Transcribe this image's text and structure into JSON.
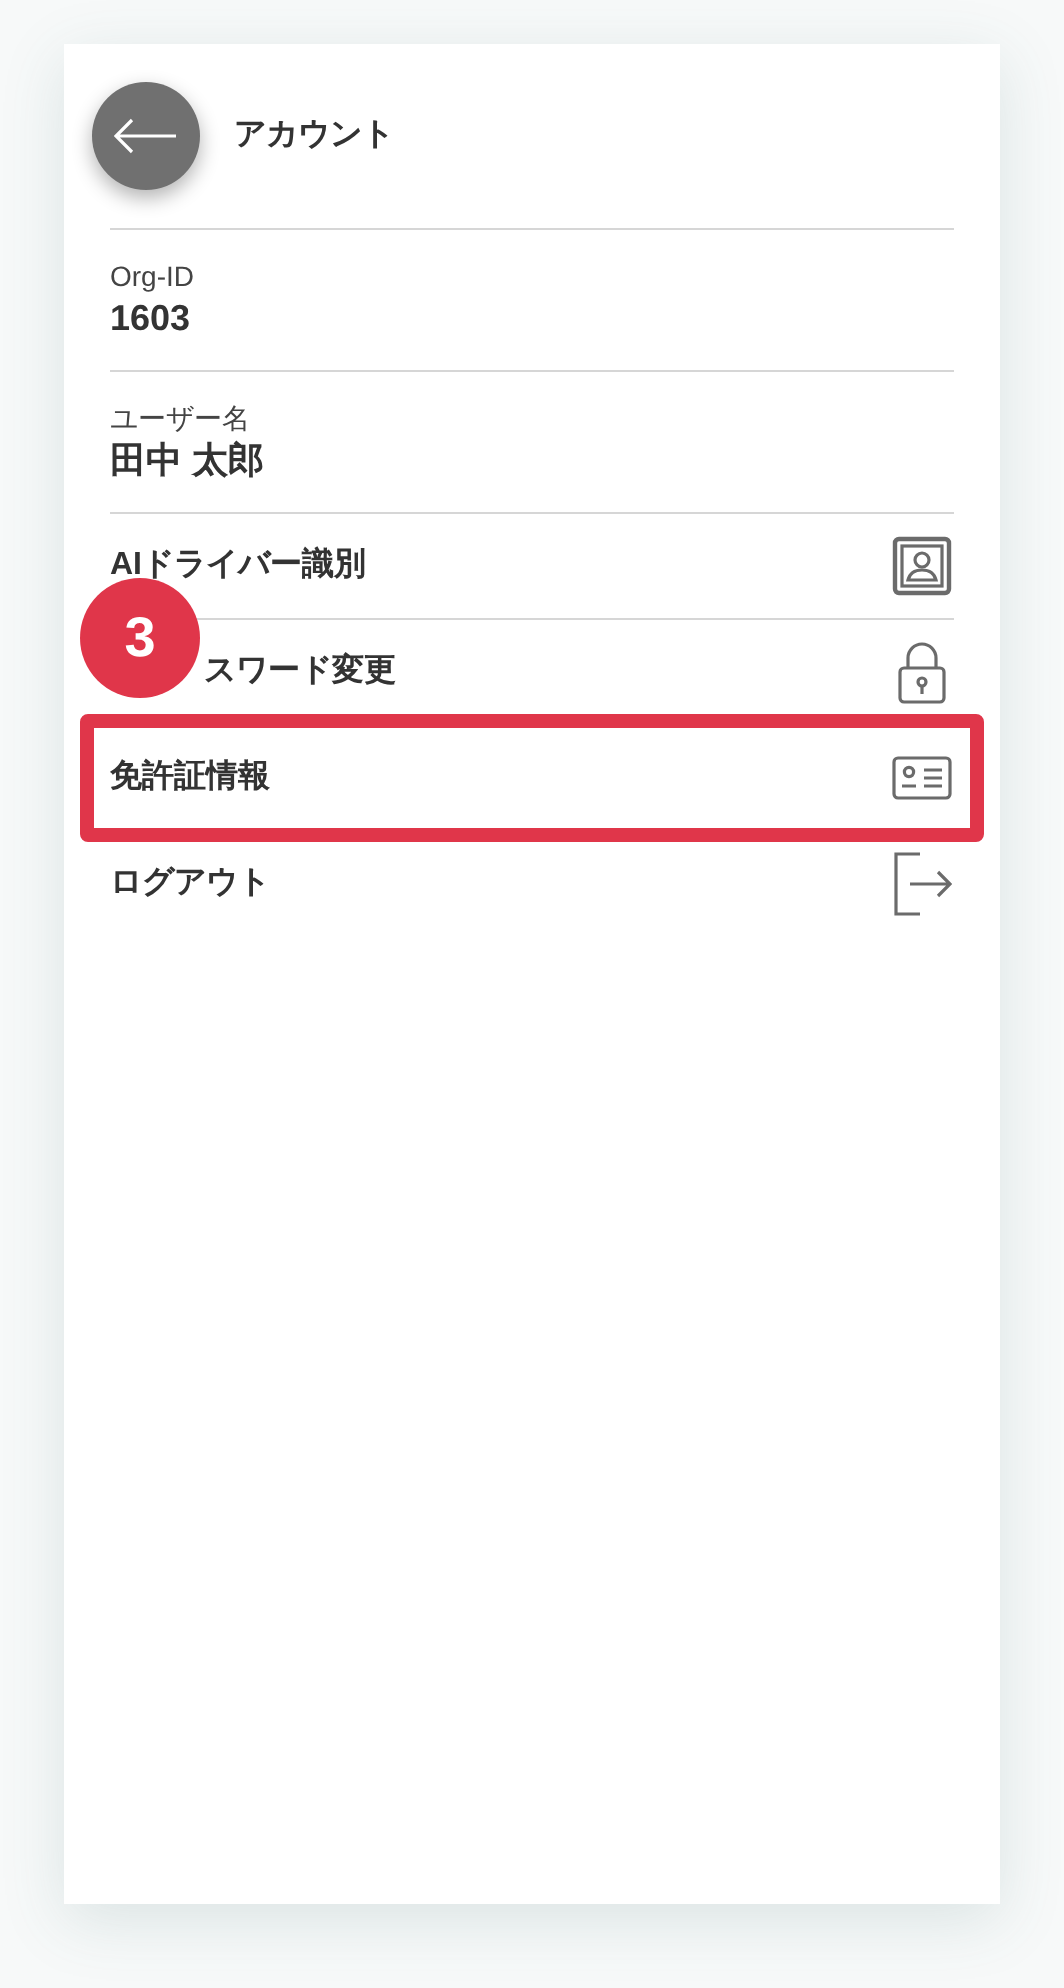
{
  "header": {
    "title": "アカウント"
  },
  "info": [
    {
      "label": "Org-ID",
      "value": "1603"
    },
    {
      "label": "ユーザー名",
      "value": "田中 太郎"
    }
  ],
  "menu": [
    {
      "label": "AIドライバー識別",
      "kind": "portrait",
      "highlighted": false
    },
    {
      "label": "スワード変更",
      "kind": "lock",
      "highlighted": false,
      "callout": "3"
    },
    {
      "label": "免許証情報",
      "kind": "card",
      "highlighted": true
    },
    {
      "label": "ログアウト",
      "kind": "logout",
      "highlighted": false
    }
  ]
}
